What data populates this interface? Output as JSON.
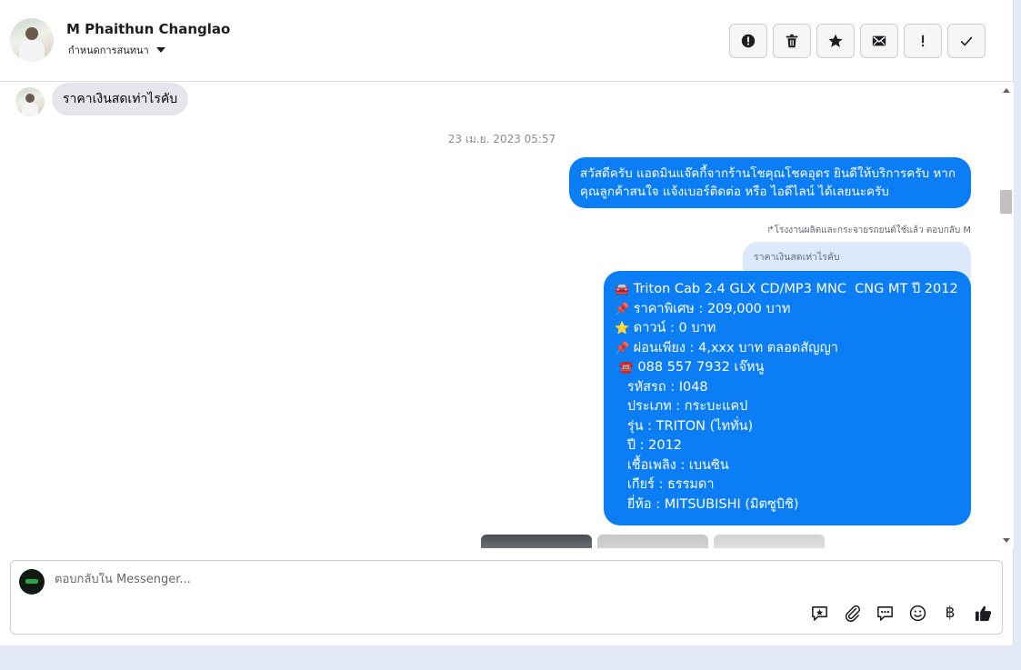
{
  "header": {
    "contact_name": "M Phaithun Changlao",
    "assign_label": "กำหนดการสนทนา",
    "actions": [
      {
        "name": "report-icon"
      },
      {
        "name": "trash-icon"
      },
      {
        "name": "star-icon"
      },
      {
        "name": "mail-icon"
      },
      {
        "name": "exclamation-icon"
      },
      {
        "name": "check-icon"
      }
    ]
  },
  "thread": {
    "incoming_message": "ราคาเงินสดเท่าไรคับ",
    "timestamp": "23 เม.ย. 2023 05:57",
    "outgoing_greeting": "สวัสดีครับ แอดมินแจ๊คกี้จากร้านโชคุณโชคอุดร ยินดีให้บริการครับ หากคุณลูกค้าสนใจ แจ้งเบอร์ติดต่อ หรือ ไอดีไลน์ ได้เลยนะครับ",
    "reply_hint": "โรงงานผลิตและกระจายรถยนต์ใช้แล้ว ตอบกลับ M",
    "quoted_text": "ราคาเงินสดเท่าไรคับ",
    "listing": {
      "line1": "Triton Cab 2.4 GLX CD/MP3 MNC  CNG MT ปี 2012",
      "line2": "ราคาพิเศษ : 209,000 บาท",
      "line3": "ดาวน์ : 0 บาท",
      "line4": "ผ่อนเพียง : 4,xxx บาท ตลอดสัญญา",
      "line5": "088 557 7932 เจ๊หนู",
      "line6": "รหัสรถ : I048",
      "line7": "ประเภท : กระบะแคป",
      "line8": "รุ่น : TRITON (ไททั่น)",
      "line9": "ปี : 2012",
      "line10": "เชื้อเพลิง : เบนซิน",
      "line11": "เกียร์ : ธรรมดา",
      "line12": "ยี่ห้อ : MITSUBISHI (มิตซูบิชิ)"
    }
  },
  "composer": {
    "placeholder": "ตอบกลับใน Messenger...",
    "tools": [
      "sticker-icon",
      "attach-icon",
      "chat-icon",
      "emoji-icon",
      "baht-icon",
      "like-icon"
    ],
    "baht_symbol": "฿"
  },
  "colors": {
    "outgoing_bubble": "#0b7ef5",
    "incoming_bubble": "#e4e6eb"
  }
}
